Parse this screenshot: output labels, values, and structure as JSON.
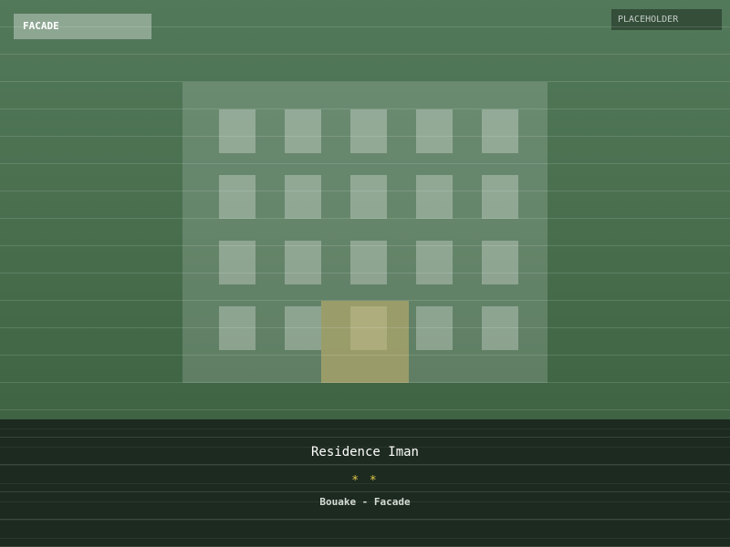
{
  "image": {
    "tag_label": "FACADE",
    "placeholder_label": "PLACEHOLDER"
  },
  "hotel": {
    "name": "Residence Iman",
    "stars_text": "* *",
    "star_rating": 2,
    "location": "Bouake - Facade"
  },
  "colors": {
    "photo_bg": "#4a7050",
    "caption_bg": "#1d2a1f",
    "star_color": "#e0c84a"
  }
}
